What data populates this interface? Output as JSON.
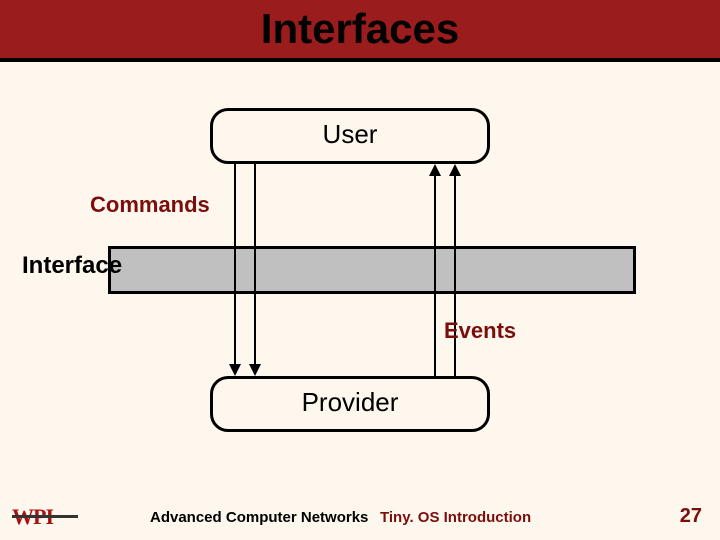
{
  "title": "Interfaces",
  "diagram": {
    "user_label": "User",
    "provider_label": "Provider",
    "interface_label": "Interface",
    "commands_label": "Commands",
    "events_label": "Events"
  },
  "footer": {
    "logo_text": "WPI",
    "course": "Advanced Computer Networks",
    "topic": "Tiny. OS Introduction",
    "page": "27"
  },
  "colors": {
    "title_bg": "#9a1c1c",
    "accent": "#7b0d0d",
    "bg": "#fdf7ed",
    "interface_fill": "#c0c0c0"
  }
}
